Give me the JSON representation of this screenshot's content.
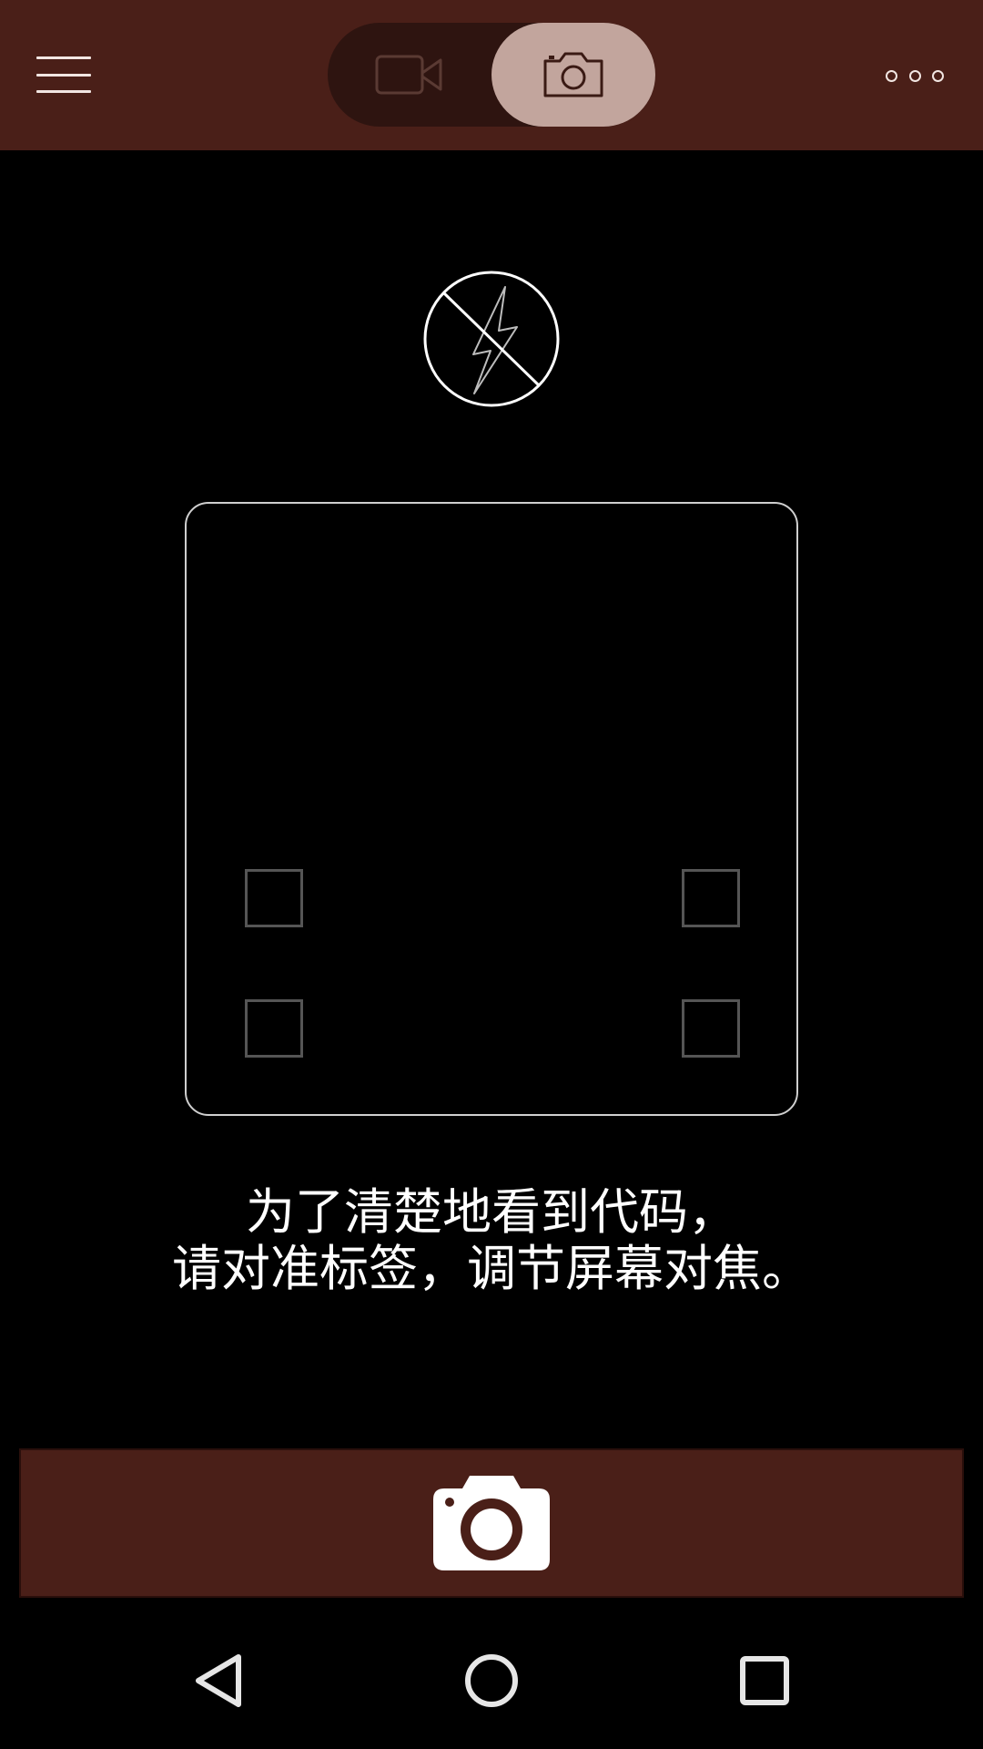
{
  "app_bar": {
    "background": "#4a1f18",
    "menu_icon": "hamburger-menu-icon",
    "mode_toggle": {
      "options": [
        {
          "id": "video",
          "icon": "video-camera-icon",
          "selected": false
        },
        {
          "id": "photo",
          "icon": "photo-camera-icon",
          "selected": true
        }
      ],
      "selected_color": "#c2a59d"
    },
    "more_icon": "more-options-icon"
  },
  "flash": {
    "icon": "flash-off-icon",
    "state": "off"
  },
  "scan_frame": {
    "corner_markers": 4
  },
  "instructions": {
    "line1": "为了清楚地看到代码，",
    "line2": "请对准标签，调节屏幕对焦。"
  },
  "shutter": {
    "icon": "camera-shutter-icon",
    "background": "#4a1f18"
  },
  "navigation": {
    "back_icon": "back-triangle-icon",
    "home_icon": "home-circle-icon",
    "recent_icon": "recent-apps-square-icon"
  }
}
